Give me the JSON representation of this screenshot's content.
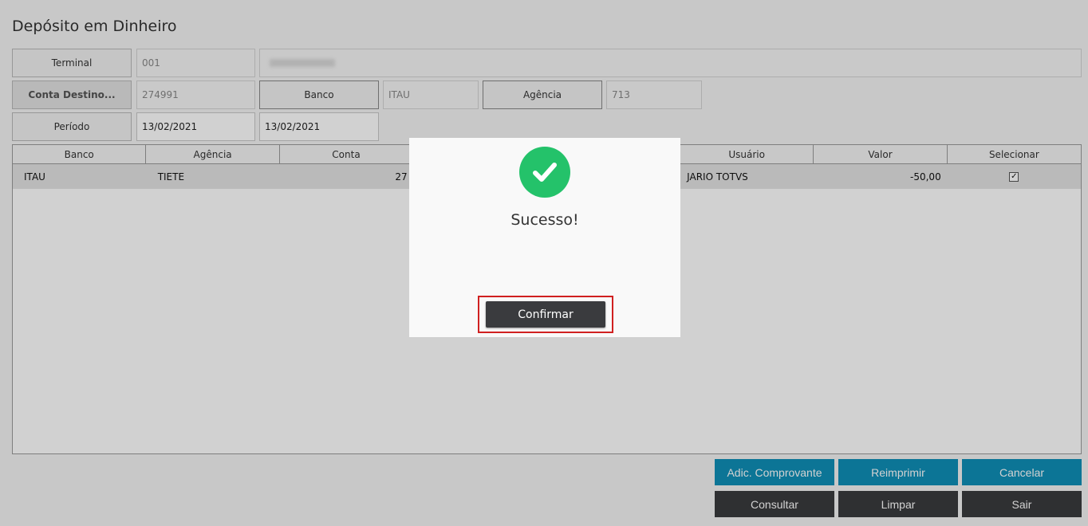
{
  "page": {
    "title": "Depósito em Dinheiro"
  },
  "form": {
    "terminal": {
      "label": "Terminal",
      "code": "001"
    },
    "conta_destino": {
      "label": "Conta Destino...",
      "value": "274991"
    },
    "banco": {
      "label": "Banco",
      "value": "ITAU"
    },
    "agencia": {
      "label": "Agência",
      "value": "713"
    },
    "periodo": {
      "label": "Período",
      "start": "13/02/2021",
      "end": "13/02/2021"
    }
  },
  "grid": {
    "columns": [
      "Banco",
      "Agência",
      "Conta",
      "",
      "",
      "Usuário",
      "Valor",
      "Selecionar"
    ],
    "rows": [
      {
        "banco": "ITAU",
        "agencia": "TIETE",
        "conta": "27",
        "usuario": "JARIO TOTVS",
        "valor": "-50,00",
        "selecionar": "✓"
      }
    ]
  },
  "actions": {
    "adic_comprovante": "Adic. Comprovante",
    "reimprimir": "Reimprimir",
    "cancelar": "Cancelar",
    "consultar": "Consultar",
    "limpar": "Limpar",
    "sair": "Sair"
  },
  "modal": {
    "title": "Sucesso!",
    "confirm_label": "Confirmar",
    "icon": "check-circle-icon",
    "icon_color": "#24c26a"
  },
  "colors": {
    "teal": "#0f8fb8",
    "dark": "#3a3b3e",
    "highlight": "#d02020"
  }
}
